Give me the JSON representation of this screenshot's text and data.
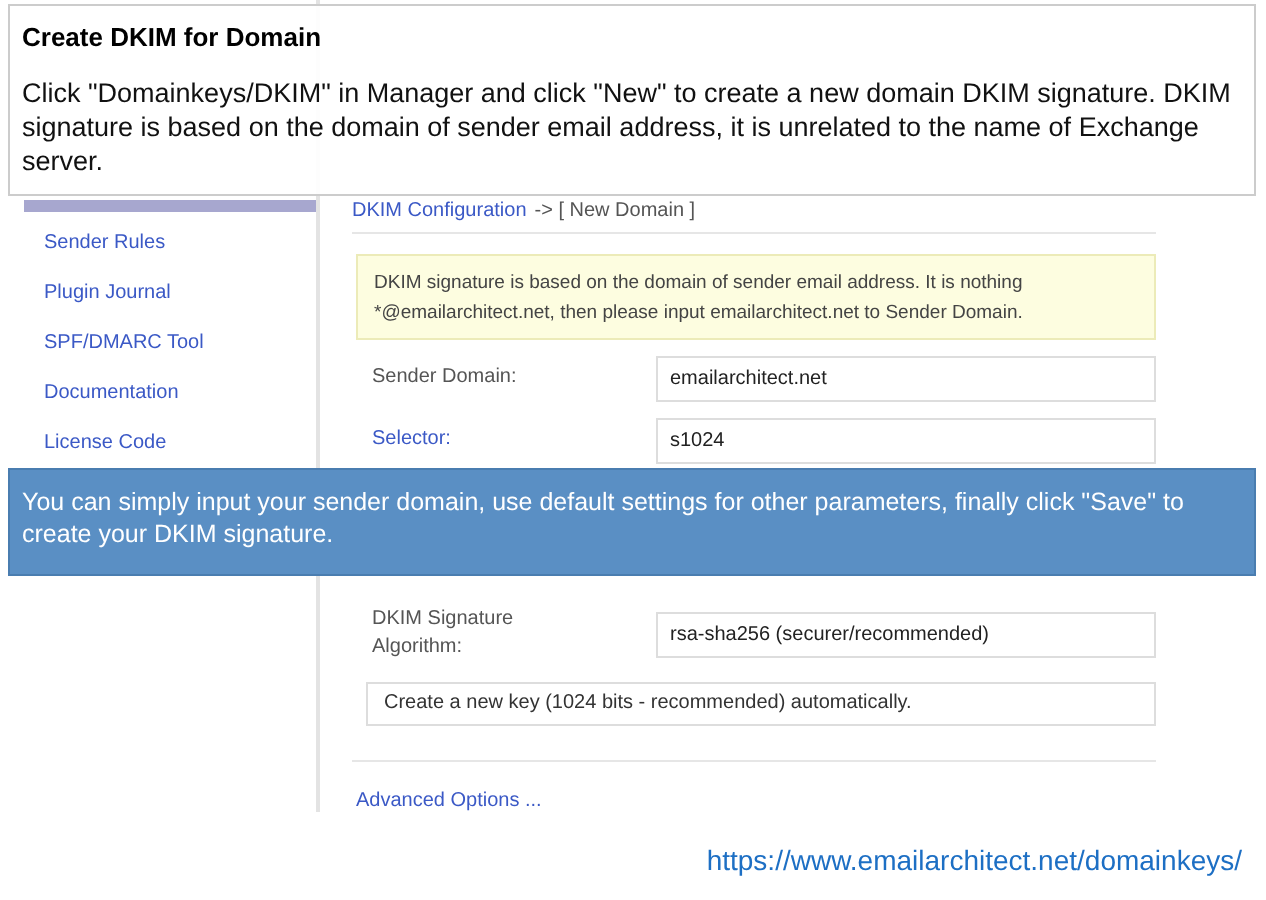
{
  "callouts": [
    {
      "kind": "note",
      "title": "Create DKIM for Domain",
      "text": "Click \"Domainkeys/DKIM\" in Manager and click \"New\" to create a new domain DKIM signature. DKIM signature is based on the domain of sender email address, it is unrelated to the name of Exchange server."
    },
    {
      "kind": "tip",
      "text": "You can simply input your sender domain, use default settings for other parameters, finally click \"Save\" to create your DKIM signature."
    }
  ],
  "sidebar": {
    "items": [
      "Sender Rules",
      "Plugin Journal",
      "SPF/DMARC Tool",
      "Documentation",
      "License Code"
    ]
  },
  "breadcrumb": {
    "link": "DKIM Configuration",
    "current": "-> [ New Domain ]"
  },
  "notice": {
    "lines": [
      "DKIM signature is based on the domain of sender email address. It is nothing",
      "*@emailarchitect.net, then please input emailarchitect.net to Sender Domain."
    ]
  },
  "form": {
    "rows": [
      {
        "label": "Sender Domain:",
        "value": "emailarchitect.net",
        "label_link": false
      },
      {
        "label": "Selector:",
        "value": "s1024",
        "label_link": true
      }
    ],
    "lower_rows": [
      {
        "label": "DKIM Signature Algorithm:",
        "value": "rsa-sha256 (securer/recommended)",
        "label_link": false
      }
    ],
    "key_option": "Create a new key (1024 bits - recommended) automatically.",
    "advanced_link": "Advanced Options ..."
  },
  "footer_url": "https://www.emailarchitect.net/domainkeys/"
}
